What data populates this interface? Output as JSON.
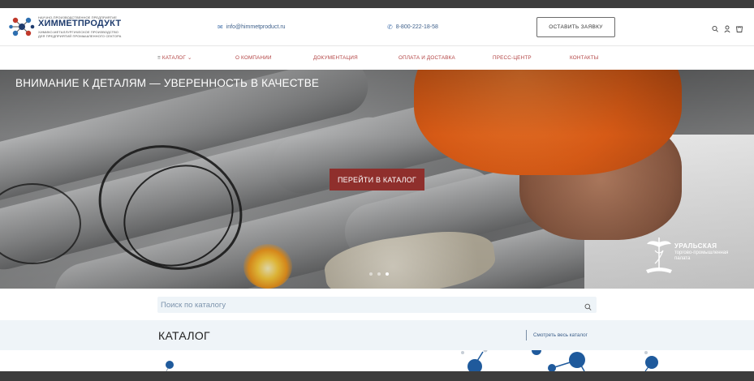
{
  "header": {
    "logo_tagline": "НАУЧНО-ПРОИЗВОДСТВЕННОЕ ПРЕДПРИЯТИЕ",
    "logo_brand": "ХИММЕТПРОДУКТ",
    "logo_desc_1": "ХИМИКО-МЕТАЛЛУРГИЧЕСКОЕ ПРОИЗВОДСТВО",
    "logo_desc_2": "ДЛЯ ПРЕДПРИЯТИЙ ПРОМЫШЛЕННОГО СЕКТОРА",
    "email": "info@himmetproduct.ru",
    "phone": "8-800-222-18-58",
    "cta_label": "ОСТАВИТЬ ЗАЯВКУ",
    "icons": [
      "search-icon",
      "user-icon",
      "cart-icon"
    ]
  },
  "nav": {
    "items": [
      {
        "label": "КАТАЛОГ"
      },
      {
        "label": "О КОМПАНИИ"
      },
      {
        "label": "ДОКУМЕНТАЦИЯ"
      },
      {
        "label": "ОПЛАТА И ДОСТАВКА"
      },
      {
        "label": "ПРЕСС-ЦЕНТР"
      },
      {
        "label": "КОНТАКТЫ"
      }
    ]
  },
  "hero": {
    "headline": "ВНИМАНИЕ К ДЕТАЛЯМ — УВЕРЕННОСТЬ В КАЧЕСТВЕ",
    "button_label": "ПЕРЕЙТИ В КАТАЛОГ",
    "slides_total": 3,
    "active_slide": 3,
    "badge_line1": "УРАЛЬСКАЯ",
    "badge_line2": "торгово-промышленная",
    "badge_line3": "палата"
  },
  "search": {
    "placeholder": "Поиск по каталогу"
  },
  "catalog": {
    "title": "КАТАЛОГ",
    "view_all": "Смотреть весь каталог"
  },
  "colors": {
    "accent": "#8f2f2c",
    "nav_text": "#b24242",
    "link": "#3d5f8a",
    "brand": "#1f3c6e"
  }
}
